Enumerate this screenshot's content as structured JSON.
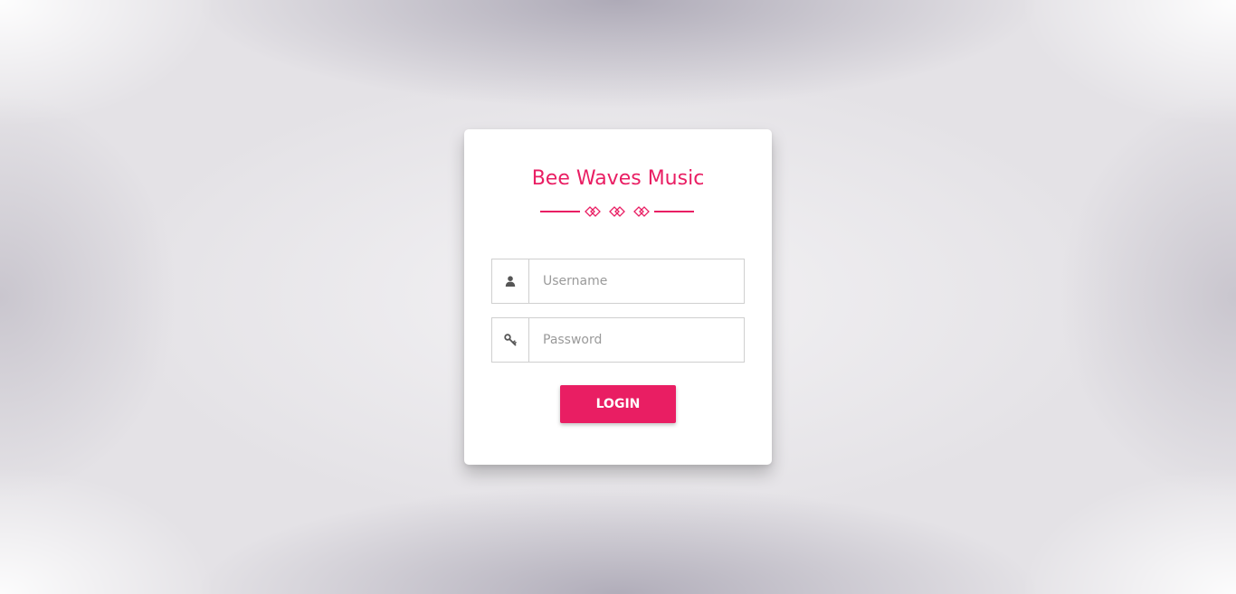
{
  "app": {
    "title": "Bee Waves Music"
  },
  "form": {
    "username": {
      "placeholder": "Username",
      "value": "",
      "icon": "user-icon"
    },
    "password": {
      "placeholder": "Password",
      "value": "",
      "icon": "key-icon"
    },
    "login_label": "LOGIN"
  },
  "colors": {
    "accent": "#e91e63",
    "card": "#ffffff",
    "icon": "#555555"
  }
}
